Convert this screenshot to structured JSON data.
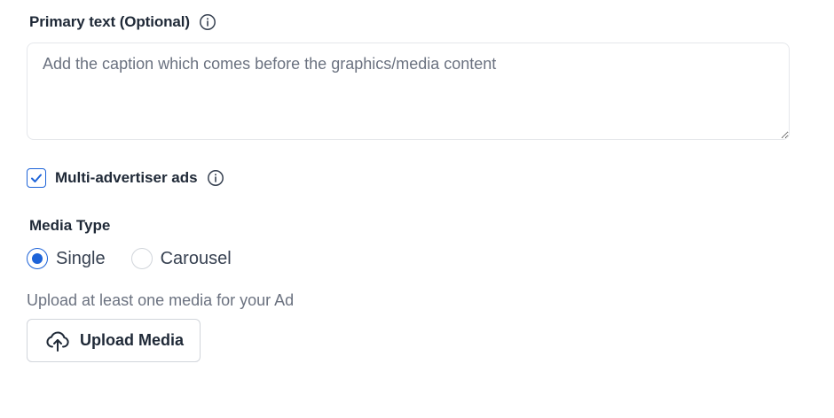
{
  "primary_text": {
    "label": "Primary text (Optional)",
    "info_icon": "info-circle-icon",
    "placeholder": "Add the caption which comes before the graphics/media content",
    "value": ""
  },
  "multi_advertiser": {
    "label": "Multi-advertiser ads",
    "checked": true,
    "info_icon": "info-circle-icon"
  },
  "media_type": {
    "label": "Media Type",
    "options": [
      {
        "label": "Single",
        "selected": true
      },
      {
        "label": "Carousel",
        "selected": false
      }
    ]
  },
  "upload": {
    "hint": "Upload at least one media for your Ad",
    "button_label": "Upload Media",
    "icon": "cloud-upload-icon"
  },
  "colors": {
    "accent": "#1d63d8",
    "text": "#1f2937",
    "muted": "#6b7280",
    "border": "#e5e7eb"
  }
}
